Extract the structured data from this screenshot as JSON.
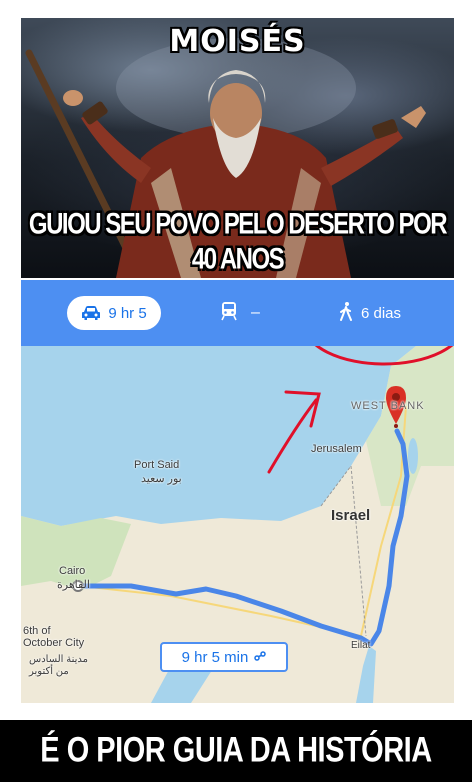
{
  "meme": {
    "top_caption": "MOISÉS",
    "middle_caption": "GUIOU SEU POVO PELO DESERTO POR 40 ANOS",
    "bottom_caption": "É O PIOR GUIA DA HISTÓRIA"
  },
  "maps": {
    "modes": {
      "drive": {
        "icon": "car-icon",
        "label": "9 hr 5",
        "selected": true
      },
      "transit": {
        "icon": "train-icon",
        "label": "–"
      },
      "walk": {
        "icon": "walking-person-icon",
        "label": "6 dias"
      }
    },
    "route_label": "9 hr 5 min",
    "places": {
      "west_bank": "WEST BANK",
      "jerusalem": "Jerusalem",
      "israel": "Israel",
      "port_said": "Port Said",
      "port_said_ar": "بور سعيد",
      "cairo": "Cairo",
      "cairo_ar": "القاهرة",
      "october_city": "6th of\nOctober City",
      "october_city_ar": "مدينة السادس\nمن أكتوبر",
      "eilat": "Eilat"
    },
    "colors": {
      "header": "#4d8ff2",
      "route": "#4a86e8",
      "water": "#a6d3ec",
      "land": "#efe9d8",
      "annotation": "#e0102a"
    }
  }
}
